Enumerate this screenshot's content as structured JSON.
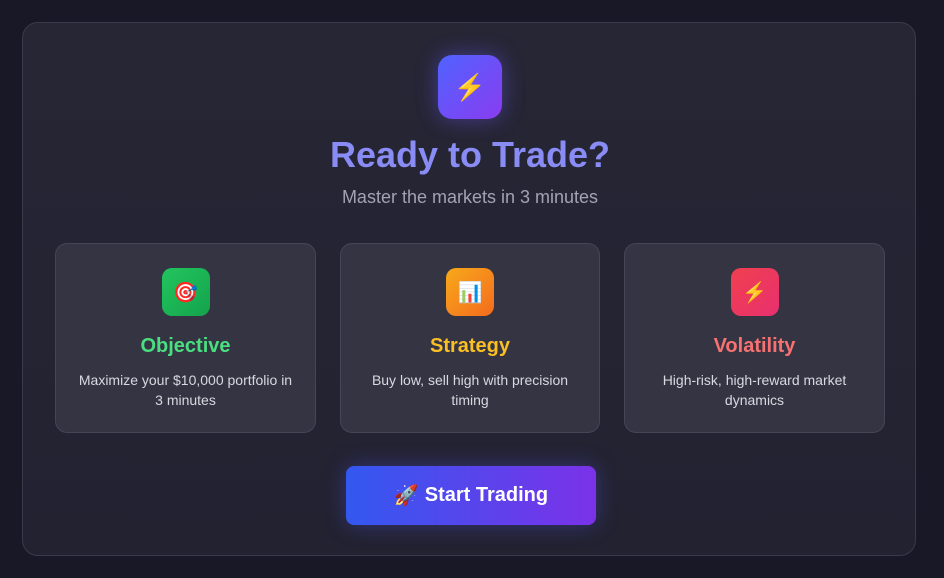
{
  "hero": {
    "icon": "⚡",
    "icon_name": "lightning-icon",
    "title": "Ready to Trade?",
    "subtitle": "Master the markets in 3 minutes"
  },
  "cards": [
    {
      "icon": "🎯",
      "icon_name": "target-icon",
      "title": "Objective",
      "description": "Maximize your $10,000 portfolio in 3 minutes",
      "title_color": "#4ade80"
    },
    {
      "icon": "📊",
      "icon_name": "bar-chart-icon",
      "title": "Strategy",
      "description": "Buy low, sell high with precision timing",
      "title_color": "#fbbf24"
    },
    {
      "icon": "⚡",
      "icon_name": "lightning-icon",
      "title": "Volatility",
      "description": "High-risk, high-reward market dynamics",
      "title_color": "#f87171"
    }
  ],
  "start_button": {
    "icon": "🚀",
    "icon_name": "rocket-icon",
    "label": "Start Trading"
  },
  "colors": {
    "background": "#181826",
    "accent": "#8a8cf5"
  }
}
